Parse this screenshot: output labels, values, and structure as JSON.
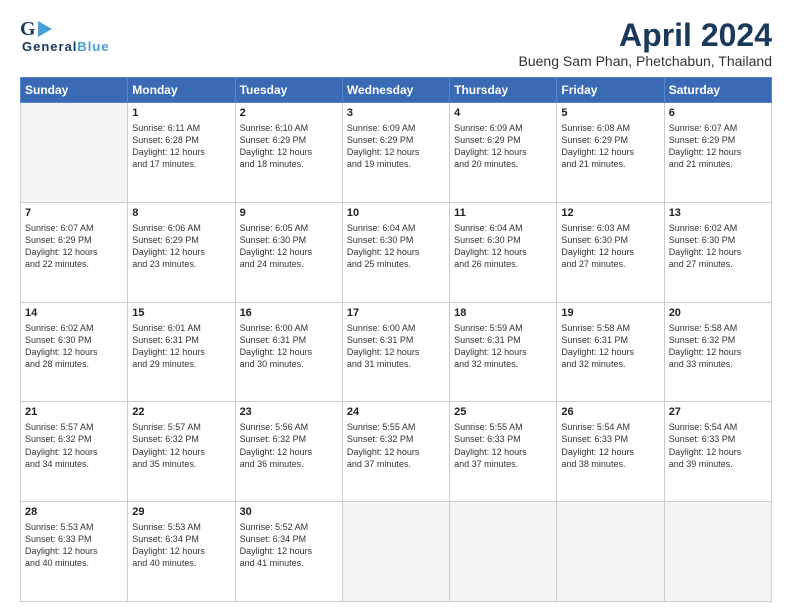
{
  "header": {
    "logo_g": "G",
    "logo_name1": "General",
    "logo_name2": "Blue",
    "month_title": "April 2024",
    "location": "Bueng Sam Phan, Phetchabun, Thailand"
  },
  "weekdays": [
    "Sunday",
    "Monday",
    "Tuesday",
    "Wednesday",
    "Thursday",
    "Friday",
    "Saturday"
  ],
  "weeks": [
    [
      {
        "day": "",
        "info": ""
      },
      {
        "day": "1",
        "info": "Sunrise: 6:11 AM\nSunset: 6:28 PM\nDaylight: 12 hours\nand 17 minutes."
      },
      {
        "day": "2",
        "info": "Sunrise: 6:10 AM\nSunset: 6:29 PM\nDaylight: 12 hours\nand 18 minutes."
      },
      {
        "day": "3",
        "info": "Sunrise: 6:09 AM\nSunset: 6:29 PM\nDaylight: 12 hours\nand 19 minutes."
      },
      {
        "day": "4",
        "info": "Sunrise: 6:09 AM\nSunset: 6:29 PM\nDaylight: 12 hours\nand 20 minutes."
      },
      {
        "day": "5",
        "info": "Sunrise: 6:08 AM\nSunset: 6:29 PM\nDaylight: 12 hours\nand 21 minutes."
      },
      {
        "day": "6",
        "info": "Sunrise: 6:07 AM\nSunset: 6:29 PM\nDaylight: 12 hours\nand 21 minutes."
      }
    ],
    [
      {
        "day": "7",
        "info": "Sunrise: 6:07 AM\nSunset: 6:29 PM\nDaylight: 12 hours\nand 22 minutes."
      },
      {
        "day": "8",
        "info": "Sunrise: 6:06 AM\nSunset: 6:29 PM\nDaylight: 12 hours\nand 23 minutes."
      },
      {
        "day": "9",
        "info": "Sunrise: 6:05 AM\nSunset: 6:30 PM\nDaylight: 12 hours\nand 24 minutes."
      },
      {
        "day": "10",
        "info": "Sunrise: 6:04 AM\nSunset: 6:30 PM\nDaylight: 12 hours\nand 25 minutes."
      },
      {
        "day": "11",
        "info": "Sunrise: 6:04 AM\nSunset: 6:30 PM\nDaylight: 12 hours\nand 26 minutes."
      },
      {
        "day": "12",
        "info": "Sunrise: 6:03 AM\nSunset: 6:30 PM\nDaylight: 12 hours\nand 27 minutes."
      },
      {
        "day": "13",
        "info": "Sunrise: 6:02 AM\nSunset: 6:30 PM\nDaylight: 12 hours\nand 27 minutes."
      }
    ],
    [
      {
        "day": "14",
        "info": "Sunrise: 6:02 AM\nSunset: 6:30 PM\nDaylight: 12 hours\nand 28 minutes."
      },
      {
        "day": "15",
        "info": "Sunrise: 6:01 AM\nSunset: 6:31 PM\nDaylight: 12 hours\nand 29 minutes."
      },
      {
        "day": "16",
        "info": "Sunrise: 6:00 AM\nSunset: 6:31 PM\nDaylight: 12 hours\nand 30 minutes."
      },
      {
        "day": "17",
        "info": "Sunrise: 6:00 AM\nSunset: 6:31 PM\nDaylight: 12 hours\nand 31 minutes."
      },
      {
        "day": "18",
        "info": "Sunrise: 5:59 AM\nSunset: 6:31 PM\nDaylight: 12 hours\nand 32 minutes."
      },
      {
        "day": "19",
        "info": "Sunrise: 5:58 AM\nSunset: 6:31 PM\nDaylight: 12 hours\nand 32 minutes."
      },
      {
        "day": "20",
        "info": "Sunrise: 5:58 AM\nSunset: 6:32 PM\nDaylight: 12 hours\nand 33 minutes."
      }
    ],
    [
      {
        "day": "21",
        "info": "Sunrise: 5:57 AM\nSunset: 6:32 PM\nDaylight: 12 hours\nand 34 minutes."
      },
      {
        "day": "22",
        "info": "Sunrise: 5:57 AM\nSunset: 6:32 PM\nDaylight: 12 hours\nand 35 minutes."
      },
      {
        "day": "23",
        "info": "Sunrise: 5:56 AM\nSunset: 6:32 PM\nDaylight: 12 hours\nand 36 minutes."
      },
      {
        "day": "24",
        "info": "Sunrise: 5:55 AM\nSunset: 6:32 PM\nDaylight: 12 hours\nand 37 minutes."
      },
      {
        "day": "25",
        "info": "Sunrise: 5:55 AM\nSunset: 6:33 PM\nDaylight: 12 hours\nand 37 minutes."
      },
      {
        "day": "26",
        "info": "Sunrise: 5:54 AM\nSunset: 6:33 PM\nDaylight: 12 hours\nand 38 minutes."
      },
      {
        "day": "27",
        "info": "Sunrise: 5:54 AM\nSunset: 6:33 PM\nDaylight: 12 hours\nand 39 minutes."
      }
    ],
    [
      {
        "day": "28",
        "info": "Sunrise: 5:53 AM\nSunset: 6:33 PM\nDaylight: 12 hours\nand 40 minutes."
      },
      {
        "day": "29",
        "info": "Sunrise: 5:53 AM\nSunset: 6:34 PM\nDaylight: 12 hours\nand 40 minutes."
      },
      {
        "day": "30",
        "info": "Sunrise: 5:52 AM\nSunset: 6:34 PM\nDaylight: 12 hours\nand 41 minutes."
      },
      {
        "day": "",
        "info": ""
      },
      {
        "day": "",
        "info": ""
      },
      {
        "day": "",
        "info": ""
      },
      {
        "day": "",
        "info": ""
      }
    ]
  ]
}
